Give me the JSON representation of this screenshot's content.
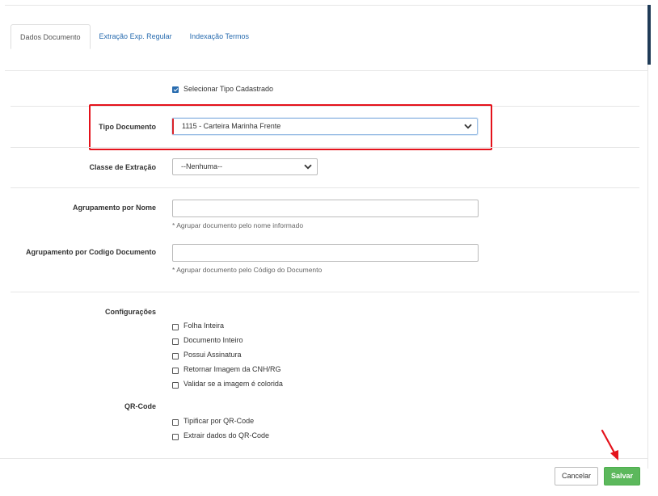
{
  "tabs": [
    {
      "label": "Dados Documento",
      "active": true
    },
    {
      "label": "Extração Exp. Regular",
      "active": false
    },
    {
      "label": "Indexação Termos",
      "active": false
    }
  ],
  "select_registered_type": {
    "label": "Selecionar Tipo Cadastrado",
    "checked": true
  },
  "tipo_documento": {
    "label": "Tipo Documento",
    "value": "1115 - Carteira Marinha Frente"
  },
  "classe_extracao": {
    "label": "Classe de Extração",
    "value": "--Nenhuma--"
  },
  "agrupamento_nome": {
    "label": "Agrupamento por Nome",
    "value": "",
    "help": "* Agrupar documento pelo nome informado"
  },
  "agrupamento_codigo": {
    "label": "Agrupamento por Codigo Documento",
    "value": "",
    "help": "* Agrupar documento pelo Código do Documento"
  },
  "configuracoes": {
    "label": "Configurações",
    "options": [
      {
        "label": "Folha Inteira",
        "checked": false
      },
      {
        "label": "Documento Inteiro",
        "checked": false
      },
      {
        "label": "Possui Assinatura",
        "checked": false
      },
      {
        "label": "Retornar Imagem da CNH/RG",
        "checked": false
      },
      {
        "label": "Validar se a imagem é colorida",
        "checked": false
      }
    ]
  },
  "qrcode": {
    "label": "QR-Code",
    "options": [
      {
        "label": "Tipificar por QR-Code",
        "checked": false
      },
      {
        "label": "Extrair dados do QR-Code",
        "checked": false
      }
    ]
  },
  "footer": {
    "cancel_label": "Cancelar",
    "save_label": "Salvar"
  },
  "colors": {
    "highlight_box": "#e4121b",
    "arrow": "#e4121b",
    "save_button": "#5cb85c",
    "link": "#2a6db0"
  },
  "icons": {
    "select_chevron": "chevron-down-icon",
    "annotation_arrow": "arrow-icon"
  }
}
